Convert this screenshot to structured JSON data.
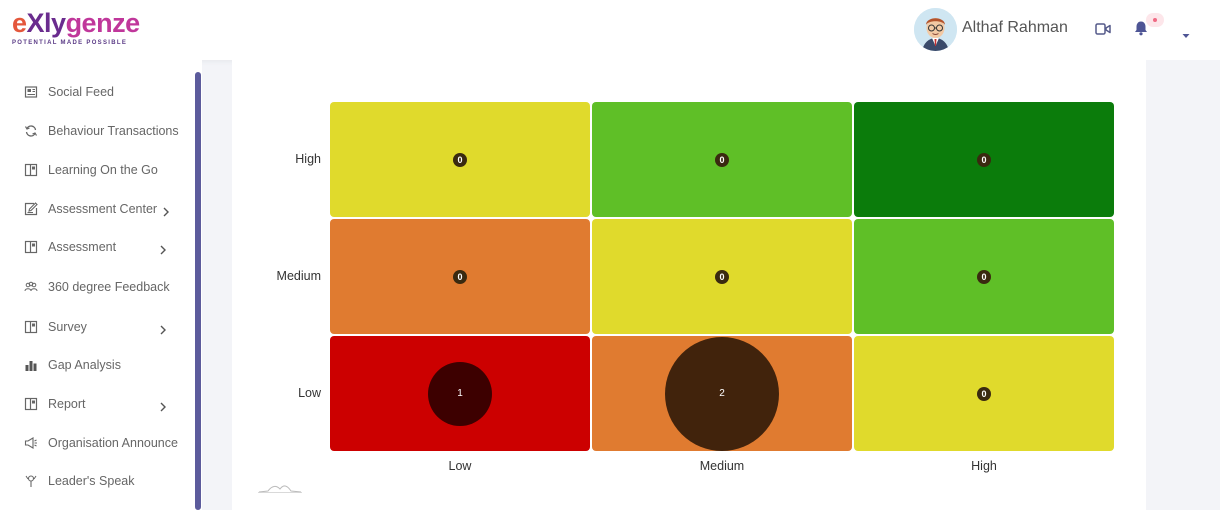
{
  "brand": {
    "logo_parts": [
      "e",
      "Xly",
      "genze"
    ],
    "tagline": "POTENTIAL MADE POSSIBLE",
    "colors": {
      "orange": "#e4573c",
      "purple": "#6a2c8e",
      "magenta": "#c0379b"
    }
  },
  "header": {
    "user_name": "Althaf Rahman",
    "icons": [
      "avatar",
      "video-icon",
      "bell-icon",
      "caret-down-icon"
    ]
  },
  "sidebar": {
    "items": [
      {
        "label": "Social Feed",
        "icon": "newspaper-icon",
        "has_submenu": false
      },
      {
        "label": "Behaviour Transactions",
        "icon": "refresh-icon",
        "has_submenu": false
      },
      {
        "label": "Learning On the Go",
        "icon": "book-icon",
        "has_submenu": false
      },
      {
        "label": "Assessment Center",
        "icon": "edit-icon",
        "has_submenu": true
      },
      {
        "label": "Assessment",
        "icon": "book-icon",
        "has_submenu": true
      },
      {
        "label": "360 degree Feedback",
        "icon": "people-icon",
        "has_submenu": false
      },
      {
        "label": "Survey",
        "icon": "book-icon",
        "has_submenu": true
      },
      {
        "label": "Gap Analysis",
        "icon": "bar-chart-icon",
        "has_submenu": false
      },
      {
        "label": "Report",
        "icon": "book-icon",
        "has_submenu": true
      },
      {
        "label": "Organisation Announce",
        "icon": "megaphone-icon",
        "has_submenu": false
      },
      {
        "label": "Leader's Speak",
        "icon": "speaker-icon",
        "has_submenu": false
      }
    ],
    "accent": "#5c5b9c"
  },
  "chart_data": {
    "type": "heatmap",
    "x_categories": [
      "Low",
      "Medium",
      "High"
    ],
    "y_categories": [
      "High",
      "Medium",
      "Low"
    ],
    "cells": [
      {
        "row": "High",
        "col": "Low",
        "value": 0,
        "color": "#e0da2c"
      },
      {
        "row": "High",
        "col": "Medium",
        "value": 0,
        "color": "#5fbf27"
      },
      {
        "row": "High",
        "col": "High",
        "value": 0,
        "color": "#0b7c0b"
      },
      {
        "row": "Medium",
        "col": "Low",
        "value": 0,
        "color": "#e07b30"
      },
      {
        "row": "Medium",
        "col": "Medium",
        "value": 0,
        "color": "#e0da2c"
      },
      {
        "row": "Medium",
        "col": "High",
        "value": 0,
        "color": "#5fbf27"
      },
      {
        "row": "Low",
        "col": "Low",
        "value": 1,
        "color": "#cc0000"
      },
      {
        "row": "Low",
        "col": "Medium",
        "value": 2,
        "color": "#e07b30"
      },
      {
        "row": "Low",
        "col": "High",
        "value": 0,
        "color": "#e0da2c"
      }
    ],
    "bubble_colors": {
      "zero": "#3a2a10",
      "low-low": "#3d0000",
      "low-medium": "#41230c"
    },
    "grid": false,
    "legend": "none"
  }
}
